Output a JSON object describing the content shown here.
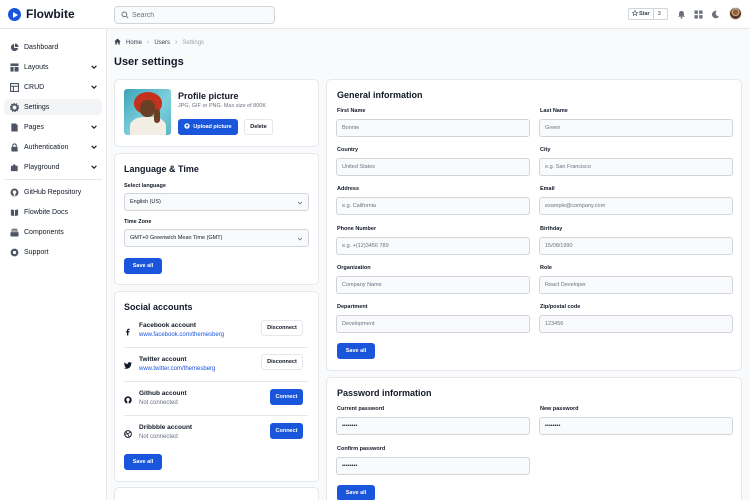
{
  "app": {
    "logo_text": "Flowbite"
  },
  "topbar": {
    "search_placeholder": "Search",
    "star_label": "Star",
    "star_count": "3",
    "icons": [
      "bell-icon",
      "apps-grid-icon",
      "moon-icon",
      "user-avatar"
    ]
  },
  "sidebar": {
    "items": [
      {
        "label": "Dashboard",
        "icon": "pie-chart-icon"
      },
      {
        "label": "Layouts",
        "icon": "layout-icon"
      },
      {
        "label": "CRUD",
        "icon": "table-icon"
      },
      {
        "label": "Settings",
        "icon": "gear-icon",
        "active": true
      },
      {
        "label": "Pages",
        "icon": "document-icon"
      },
      {
        "label": "Authentication",
        "icon": "lock-icon"
      },
      {
        "label": "Playground",
        "icon": "puzzle-icon"
      }
    ],
    "links": [
      {
        "label": "GitHub Repository",
        "icon": "github-icon"
      },
      {
        "label": "Flowbite Docs",
        "icon": "book-icon"
      },
      {
        "label": "Components",
        "icon": "collection-icon"
      },
      {
        "label": "Support",
        "icon": "lifebuoy-icon"
      }
    ]
  },
  "breadcrumb": {
    "home": "Home",
    "users": "Users",
    "current": "Settings"
  },
  "page": {
    "title": "User settings"
  },
  "profile": {
    "title": "Profile picture",
    "hint": "JPG, GIF or PNG. Max size of 800K",
    "upload_label": "Upload picture",
    "delete_label": "Delete"
  },
  "language_time": {
    "title": "Language & Time",
    "language_label": "Select language",
    "language_value": "English (US)",
    "timezone_label": "Time Zone",
    "timezone_value": "GMT+0 Greenwich Mean Time (GMT)",
    "save_label": "Save all"
  },
  "social": {
    "title": "Social accounts",
    "accounts": [
      {
        "name": "Facebook account",
        "sub": "www.facebook.com/themesberg",
        "linked": true,
        "action": "Disconnect"
      },
      {
        "name": "Twitter account",
        "sub": "www.twitter.com/themesberg",
        "linked": true,
        "action": "Disconnect"
      },
      {
        "name": "Github account",
        "sub": "Not connected",
        "linked": false,
        "action": "Connect"
      },
      {
        "name": "Dribbble account",
        "sub": "Not connected",
        "linked": false,
        "action": "Connect"
      }
    ],
    "save_label": "Save all"
  },
  "general": {
    "title": "General information",
    "fields": {
      "first_name": {
        "label": "First Name",
        "placeholder": "Bonnie"
      },
      "last_name": {
        "label": "Last Name",
        "placeholder": "Green"
      },
      "country": {
        "label": "Country",
        "placeholder": "United States"
      },
      "city": {
        "label": "City",
        "placeholder": "e.g. San Francisco"
      },
      "address": {
        "label": "Address",
        "placeholder": "e.g. California"
      },
      "email": {
        "label": "Email",
        "placeholder": "example@company.com"
      },
      "phone": {
        "label": "Phone Number",
        "placeholder": "e.g. +(12)3456 789"
      },
      "birthday": {
        "label": "Birthday",
        "placeholder": "15/08/1990"
      },
      "organization": {
        "label": "Organization",
        "placeholder": "Company Name"
      },
      "role": {
        "label": "Role",
        "placeholder": "React Developer"
      },
      "department": {
        "label": "Department",
        "placeholder": "Development"
      },
      "zip": {
        "label": "Zip/postal code",
        "placeholder": "123456"
      }
    },
    "save_label": "Save all"
  },
  "password": {
    "title": "Password information",
    "current_label": "Current password",
    "current_value": "••••••••",
    "new_label": "New password",
    "new_value": "••••••••",
    "confirm_label": "Confirm password",
    "confirm_value": "••••••••",
    "save_label": "Save all"
  },
  "colors": {
    "primary": "#1a56db",
    "border": "#e5e7eb",
    "background": "#f9fafb"
  }
}
